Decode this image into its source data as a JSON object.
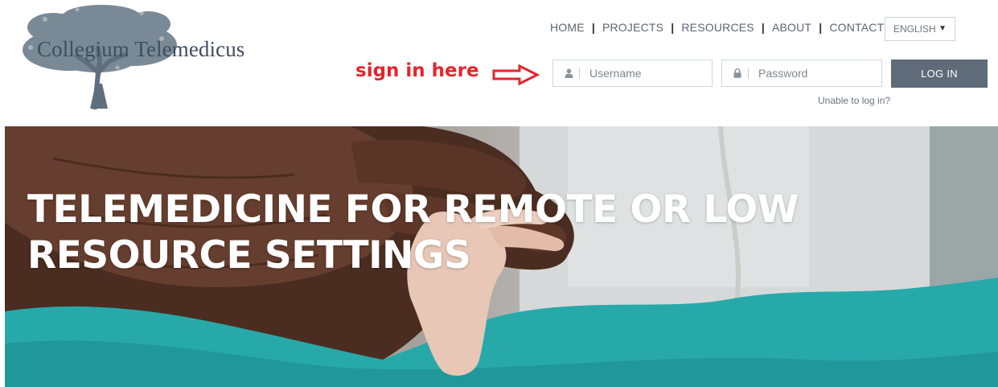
{
  "brand": {
    "name": "Collegium Telemedicus",
    "logo_icon": "tree-icon"
  },
  "nav": {
    "items": [
      {
        "label": "HOME"
      },
      {
        "label": "PROJECTS"
      },
      {
        "label": "RESOURCES"
      },
      {
        "label": "ABOUT"
      },
      {
        "label": "CONTACT"
      }
    ],
    "separator": "|"
  },
  "language": {
    "selected": "ENGLISH",
    "caret": "▼"
  },
  "login": {
    "annotation": "sign in here",
    "annotation_color": "#e3262c",
    "username": {
      "placeholder": "Username",
      "value": "",
      "icon": "user-icon"
    },
    "password": {
      "placeholder": "Password",
      "value": "",
      "icon": "lock-icon"
    },
    "submit_label": "LOG IN",
    "help_link": "Unable to log in?"
  },
  "hero": {
    "title": "TELEMEDICINE FOR REMOTE OR LOW RESOURCE SETTINGS",
    "image_description_icon": "hands-photo"
  },
  "colors": {
    "accent_button": "#5f6b78",
    "nav_text": "#5b6672",
    "logo_text": "#3f4e5c",
    "annotation_red": "#e3262c",
    "hero_teal": "#27a9aa"
  }
}
